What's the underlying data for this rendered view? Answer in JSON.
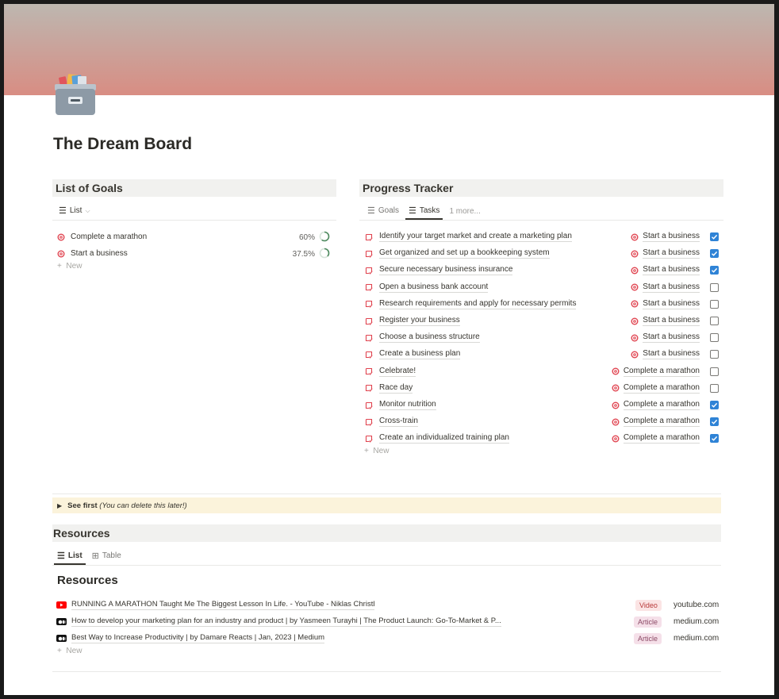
{
  "page": {
    "title": "The Dream Board",
    "cover_colors": [
      "#bdb7b0",
      "#d88d83"
    ],
    "icon": "card-file-box-icon"
  },
  "goals": {
    "heading": "List of Goals",
    "view_label": "List",
    "items": [
      {
        "name": "Complete a marathon",
        "progress_label": "60%",
        "progress": 0.6
      },
      {
        "name": "Start a business",
        "progress_label": "37.5%",
        "progress": 0.375
      }
    ],
    "new_label": "New"
  },
  "tracker": {
    "heading": "Progress Tracker",
    "tabs": [
      {
        "label": "Goals",
        "active": false
      },
      {
        "label": "Tasks",
        "active": true
      }
    ],
    "more_label": "1 more...",
    "tasks": [
      {
        "name": "Identify your target market and create a marketing plan",
        "goal": "Start a business",
        "done": true
      },
      {
        "name": "Get organized and set up a bookkeeping system",
        "goal": "Start a business",
        "done": true
      },
      {
        "name": "Secure necessary business insurance",
        "goal": "Start a business",
        "done": true
      },
      {
        "name": "Open a business bank account",
        "goal": "Start a business",
        "done": false
      },
      {
        "name": "Research requirements and apply for necessary permits",
        "goal": "Start a business",
        "done": false
      },
      {
        "name": "Register your business",
        "goal": "Start a business",
        "done": false
      },
      {
        "name": "Choose a business structure",
        "goal": "Start a business",
        "done": false
      },
      {
        "name": "Create a business plan",
        "goal": "Start a business",
        "done": false
      },
      {
        "name": "Celebrate!",
        "goal": "Complete a marathon",
        "done": false
      },
      {
        "name": "Race day",
        "goal": "Complete a marathon",
        "done": false
      },
      {
        "name": "Monitor nutrition",
        "goal": "Complete a marathon",
        "done": true
      },
      {
        "name": "Cross-train",
        "goal": "Complete a marathon",
        "done": true
      },
      {
        "name": "Create an individualized training plan",
        "goal": "Complete a marathon",
        "done": true
      }
    ],
    "new_label": "New"
  },
  "callout": {
    "label": "See first",
    "note": "(You can delete this later!)"
  },
  "resources": {
    "heading": "Resources",
    "tabs": [
      {
        "label": "List",
        "active": true
      },
      {
        "label": "Table",
        "active": false
      }
    ],
    "subheading": "Resources",
    "items": [
      {
        "title": "RUNNING A MARATHON Taught Me The Biggest Lesson In Life. - YouTube - Niklas Christl",
        "type": "Video",
        "domain": "youtube.com",
        "source_icon": "youtube-icon"
      },
      {
        "title": "How to develop your marketing plan for an industry and product | by Yasmeen Turayhi | The Product Launch: Go-To-Market & P...",
        "type": "Article",
        "domain": "medium.com",
        "source_icon": "medium-icon"
      },
      {
        "title": "Best Way to Increase Productivity | by Damare Reacts | Jan, 2023 | Medium",
        "type": "Article",
        "domain": "medium.com",
        "source_icon": "medium-icon"
      }
    ],
    "new_label": "New"
  },
  "colors": {
    "checkbox_on": "#2f83d6",
    "progress_ring": "#4e8a5f",
    "goal_icon": "#e0434f",
    "task_icon": "#e0434f",
    "video_tag_bg": "#fbe4e4",
    "article_tag_bg": "#f5e0e9",
    "callout_bg": "#fbf3db"
  }
}
